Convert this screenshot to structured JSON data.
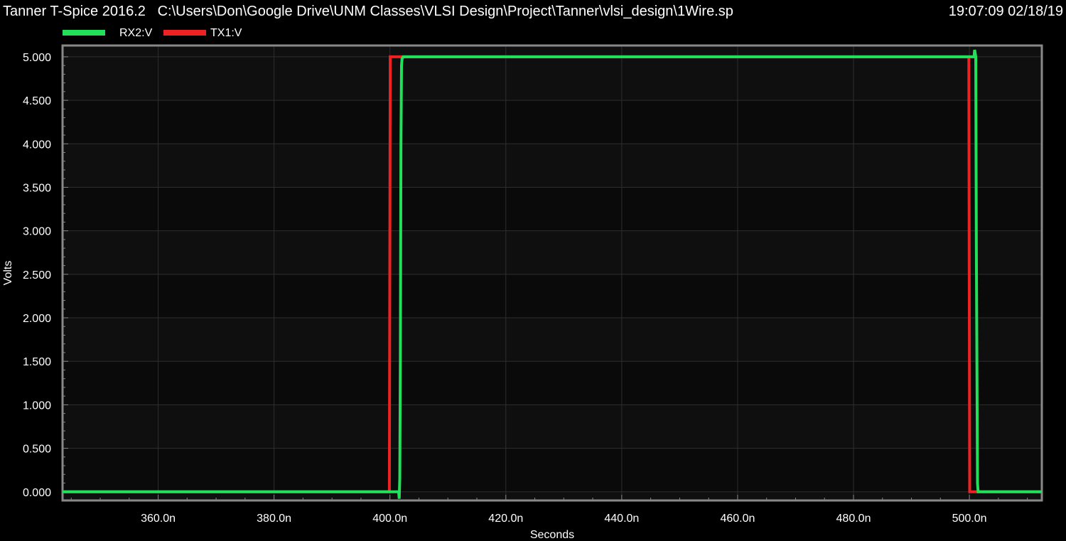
{
  "header": {
    "app_title": "Tanner T-Spice 2016.2",
    "file_path": "C:\\Users\\Don\\Google Drive\\UNM Classes\\VLSI Design\\Project\\Tanner\\vlsi_design\\1Wire.sp",
    "timestamp": "19:07:09 02/18/19"
  },
  "colors": {
    "background": "#000000",
    "plot_background": "#0f0f0f",
    "band_dark": "#0a0a0a",
    "grid": "#2e2e2e",
    "frame": "#888888",
    "rx2": "#22e05a",
    "tx1": "#ee2222"
  },
  "chart_data": {
    "type": "line",
    "xlabel": "Seconds",
    "ylabel": "Volts",
    "xlim": [
      343.5,
      512.5
    ],
    "ylim": [
      -0.1,
      5.13
    ],
    "x_unit_suffix": "n",
    "xticks": [
      360,
      380,
      400,
      420,
      440,
      460,
      480,
      500
    ],
    "xtick_labels": [
      "360.0n",
      "380.0n",
      "400.0n",
      "420.0n",
      "440.0n",
      "460.0n",
      "480.0n",
      "500.0n"
    ],
    "yticks": [
      0,
      0.5,
      1,
      1.5,
      2,
      2.5,
      3,
      3.5,
      4,
      4.5,
      5
    ],
    "ytick_labels": [
      "0.000",
      "0.500",
      "1.000",
      "1.500",
      "2.000",
      "2.500",
      "3.000",
      "3.500",
      "4.000",
      "4.500",
      "5.000"
    ],
    "grid": true,
    "legend_position": "top-left",
    "series": [
      {
        "name": "RX2:V",
        "color": "#22e05a",
        "x": [
          343.5,
          400.0,
          401.5,
          401.6,
          401.7,
          401.8,
          401.9,
          402.0,
          402.1,
          402.3,
          500.8,
          500.9,
          501.1,
          501.2,
          501.4,
          501.5,
          512.5
        ],
        "y": [
          0,
          0,
          0,
          -0.08,
          0.15,
          1.5,
          4.0,
          4.9,
          4.98,
          5.0,
          5.0,
          5.08,
          5.0,
          2.8,
          0.1,
          0.0,
          0.0
        ]
      },
      {
        "name": "TX1:V",
        "color": "#ee2222",
        "x": [
          343.5,
          399.9,
          400.05,
          499.9,
          500.05,
          512.5
        ],
        "y": [
          0,
          0,
          5.0,
          5.0,
          0,
          0
        ]
      }
    ]
  }
}
